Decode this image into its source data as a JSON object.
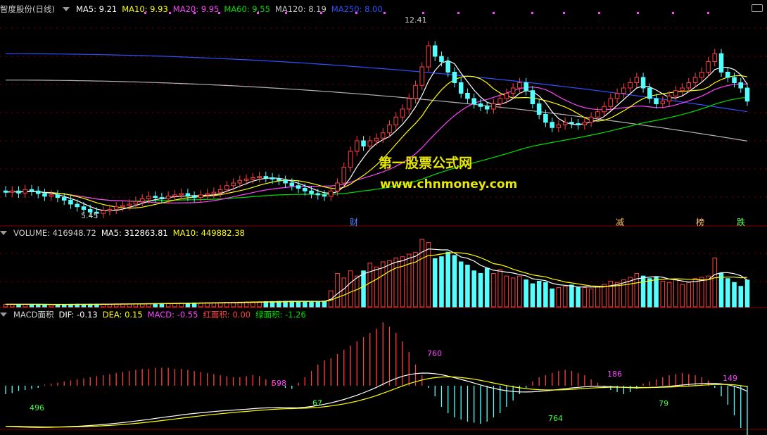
{
  "price_header": {
    "stock": "智度股份(日线)",
    "ma5": "MA5: 9.21",
    "ma10": "MA10: 9.93",
    "ma20": "MA20: 9.95",
    "ma60": "MA60: 9.55",
    "ma120": "MA120: 8.19",
    "ma250": "MA250: 8.00"
  },
  "volume_header": {
    "title": "VOLUME: 416948.72",
    "ma5": "MA5: 312863.81",
    "ma10": "MA10: 449882.38"
  },
  "macd_header": {
    "title": "MACD面积",
    "dif": "DIF: -0.13",
    "dea": "DEA: 0.15",
    "macd": "MACD: -0.55",
    "red_area": "红面积: 0.00",
    "green_area": "绿面积: -1.26"
  },
  "watermark": {
    "line1": "第一股票公式网",
    "line2": "www.chnmoney.com"
  },
  "price_annotations": {
    "high": "12.41",
    "low": "5.45"
  },
  "event_markers": [
    "财",
    "减",
    "榜",
    "跌"
  ],
  "macd_labels": [
    "496",
    "598",
    "67",
    "760",
    "764",
    "186",
    "79",
    "149"
  ],
  "colors": {
    "up": "#ff4040",
    "down": "#54ffff",
    "ma5": "#ffffff",
    "ma10": "#ffff00",
    "ma20": "#ff44ff",
    "ma60": "#00e000",
    "ma120": "#b0b0b0",
    "ma250": "#3050ff",
    "grid": "#8b0000"
  },
  "chart_data": [
    {
      "type": "candlestick",
      "title": "智度股份(日线)",
      "ylim": [
        5.0,
        13.0
      ],
      "high": 12.41,
      "low": 5.45,
      "ma_last": {
        "MA5": 9.21,
        "MA10": 9.93,
        "MA20": 9.95,
        "MA60": 9.55,
        "MA120": 8.19,
        "MA250": 8.0
      },
      "close": [
        6.25,
        6.3,
        6.22,
        6.35,
        6.3,
        6.2,
        6.1,
        6.15,
        6.05,
        5.95,
        5.8,
        5.7,
        5.6,
        5.5,
        5.45,
        5.55,
        5.6,
        5.7,
        5.75,
        5.8,
        5.9,
        6.0,
        6.1,
        6.05,
        6.0,
        6.1,
        6.15,
        6.2,
        6.1,
        6.05,
        6.15,
        6.2,
        6.25,
        6.35,
        6.5,
        6.6,
        6.7,
        6.75,
        6.8,
        6.85,
        6.8,
        6.75,
        6.7,
        6.6,
        6.5,
        6.4,
        6.3,
        6.2,
        6.15,
        6.1,
        6.3,
        6.6,
        7.2,
        7.8,
        8.2,
        8.0,
        8.2,
        8.3,
        8.5,
        8.8,
        9.1,
        9.4,
        9.8,
        10.3,
        11.0,
        11.8,
        11.4,
        11.2,
        10.8,
        10.4,
        10.0,
        9.8,
        9.6,
        9.5,
        9.4,
        9.6,
        9.8,
        10.0,
        10.2,
        10.4,
        10.1,
        9.6,
        9.2,
        8.9,
        8.7,
        8.8,
        8.9,
        8.85,
        8.8,
        8.9,
        9.1,
        9.3,
        9.5,
        9.8,
        10.0,
        10.2,
        10.4,
        10.6,
        10.2,
        9.8,
        9.6,
        9.7,
        9.9,
        10.1,
        10.2,
        10.4,
        10.6,
        10.8,
        11.2,
        11.5,
        10.8,
        10.6,
        10.4,
        10.2,
        9.7
      ],
      "open": [
        6.3,
        6.25,
        6.3,
        6.22,
        6.35,
        6.3,
        6.2,
        6.1,
        6.15,
        6.05,
        5.95,
        5.8,
        5.7,
        5.6,
        5.5,
        5.45,
        5.55,
        5.6,
        5.7,
        5.75,
        5.8,
        5.9,
        6.0,
        6.1,
        6.05,
        6.0,
        6.1,
        6.15,
        6.2,
        6.1,
        6.05,
        6.15,
        6.2,
        6.25,
        6.35,
        6.5,
        6.6,
        6.7,
        6.75,
        6.8,
        6.85,
        6.8,
        6.75,
        6.7,
        6.6,
        6.5,
        6.4,
        6.3,
        6.2,
        6.15,
        6.1,
        6.3,
        6.6,
        7.2,
        7.8,
        8.2,
        8.0,
        8.2,
        8.3,
        8.5,
        8.8,
        9.1,
        9.4,
        9.8,
        10.3,
        11.0,
        11.8,
        11.4,
        11.2,
        10.8,
        10.4,
        10.0,
        9.8,
        9.6,
        9.5,
        9.4,
        9.6,
        9.8,
        10.0,
        10.2,
        10.4,
        10.1,
        9.6,
        9.2,
        8.9,
        8.7,
        8.8,
        8.9,
        8.85,
        8.8,
        8.9,
        9.1,
        9.3,
        9.5,
        9.8,
        10.0,
        10.2,
        10.4,
        10.6,
        10.2,
        9.8,
        9.6,
        9.7,
        9.9,
        10.1,
        10.2,
        10.4,
        10.6,
        10.8,
        11.2,
        11.5,
        10.8,
        10.6,
        10.4,
        10.2
      ]
    },
    {
      "type": "bar",
      "title": "VOLUME",
      "last": 416948.72,
      "ma_last": {
        "MA5": 312863.81,
        "MA10": 449882.38
      },
      "values": [
        40000,
        42000,
        38000,
        41000,
        39000,
        36000,
        37000,
        35000,
        38000,
        36000,
        40000,
        42000,
        39000,
        41000,
        43000,
        45000,
        44000,
        46000,
        47000,
        48000,
        49000,
        50000,
        52000,
        53000,
        55000,
        57000,
        58000,
        60000,
        59000,
        62000,
        64000,
        65000,
        66000,
        68000,
        70000,
        72000,
        74000,
        76000,
        78000,
        80000,
        82000,
        84000,
        86000,
        88000,
        90000,
        88000,
        86000,
        84000,
        82000,
        90000,
        250000,
        520000,
        450000,
        560000,
        480000,
        560000,
        680000,
        620000,
        700000,
        720000,
        760000,
        780000,
        820000,
        850000,
        1050000,
        1000000,
        750000,
        780000,
        850000,
        800000,
        700000,
        650000,
        560000,
        520000,
        600000,
        520000,
        580000,
        480000,
        450000,
        480000,
        420000,
        360000,
        400000,
        380000,
        280000,
        300000,
        320000,
        340000,
        300000,
        300000,
        280000,
        320000,
        350000,
        400000,
        380000,
        420000,
        460000,
        520000,
        480000,
        440000,
        460000,
        400000,
        380000,
        420000,
        350000,
        380000,
        440000,
        460000,
        480000,
        760000,
        520000,
        440000,
        380000,
        320000,
        416948
      ]
    },
    {
      "type": "bar",
      "title": "MACD面积",
      "series": [
        {
          "name": "DIF",
          "last": -0.13
        },
        {
          "name": "DEA",
          "last": 0.15
        },
        {
          "name": "MACD",
          "last": -0.55
        }
      ],
      "red_area": 0.0,
      "green_area": -1.26,
      "values": [
        -0.08,
        -0.07,
        -0.05,
        -0.04,
        -0.03,
        -0.02,
        0.01,
        0.02,
        0.03,
        0.04,
        0.05,
        0.06,
        0.07,
        0.08,
        0.09,
        0.1,
        0.11,
        0.12,
        0.13,
        0.14,
        0.15,
        0.16,
        0.16,
        0.17,
        0.17,
        0.17,
        0.16,
        0.16,
        0.15,
        0.14,
        0.13,
        0.12,
        0.11,
        0.1,
        0.09,
        0.08,
        0.08,
        0.09,
        0.1,
        0.09,
        0.06,
        0.04,
        0.02,
        -0.02,
        -0.03,
        0.03,
        0.08,
        0.14,
        0.2,
        0.24,
        0.26,
        0.3,
        0.34,
        0.38,
        0.42,
        0.46,
        0.5,
        0.54,
        0.6,
        0.56,
        0.5,
        0.42,
        0.32,
        0.2,
        0.1,
        -0.02,
        -0.1,
        -0.2,
        -0.26,
        -0.3,
        -0.32,
        -0.34,
        -0.35,
        -0.36,
        -0.34,
        -0.3,
        -0.26,
        -0.2,
        -0.14,
        -0.08,
        -0.02,
        0.04,
        0.08,
        0.1,
        0.12,
        0.14,
        0.15,
        0.14,
        0.12,
        0.1,
        0.06,
        0.03,
        -0.02,
        -0.04,
        -0.06,
        -0.08,
        -0.06,
        -0.03,
        0.02,
        0.04,
        0.06,
        0.08,
        0.1,
        0.11,
        0.12,
        0.11,
        0.1,
        0.08,
        0.05,
        -0.02,
        -0.1,
        -0.18,
        -0.28,
        -0.4,
        -0.55
      ]
    }
  ]
}
